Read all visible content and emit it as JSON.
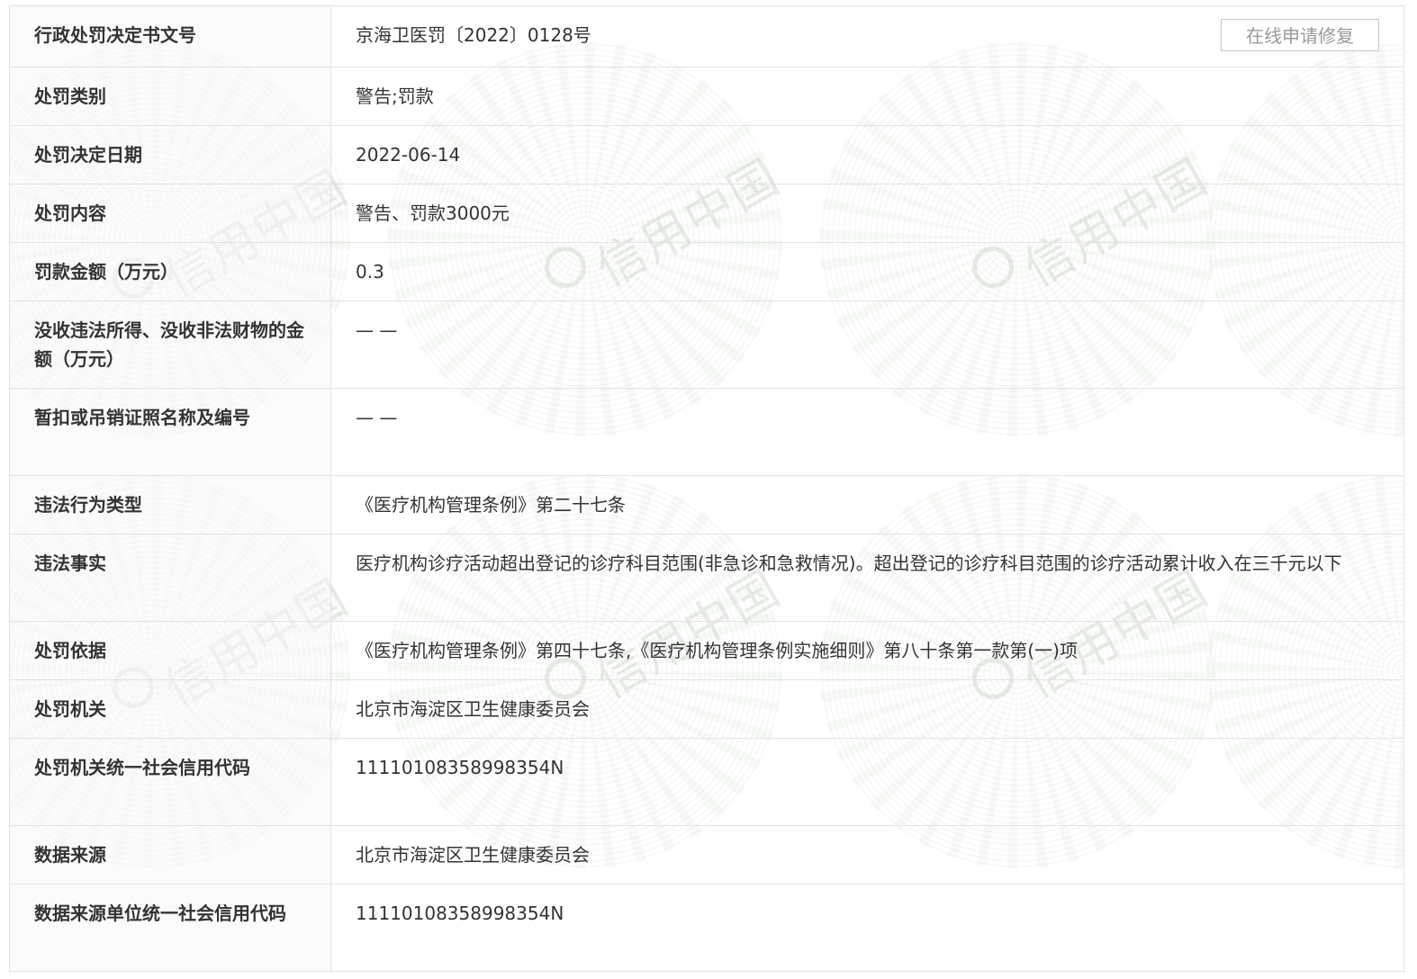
{
  "repair_button_label": "在线申请修复",
  "rows": [
    {
      "label": "行政处罚决定书文号",
      "value": "京海卫医罚〔2022〕0128号"
    },
    {
      "label": "处罚类别",
      "value": "警告;罚款"
    },
    {
      "label": "处罚决定日期",
      "value": "2022-06-14"
    },
    {
      "label": "处罚内容",
      "value": "警告、罚款3000元"
    },
    {
      "label": "罚款金额（万元）",
      "value": "0.3"
    },
    {
      "label": "没收违法所得、没收非法财物的金额（万元）",
      "value": "— —"
    },
    {
      "label": "暂扣或吊销证照名称及编号",
      "value": "— —"
    },
    {
      "label": "违法行为类型",
      "value": "《医疗机构管理条例》第二十七条"
    },
    {
      "label": "违法事实",
      "value": "医疗机构诊疗活动超出登记的诊疗科目范围(非急诊和急救情况)。超出登记的诊疗科目范围的诊疗活动累计收入在三千元以下"
    },
    {
      "label": "处罚依据",
      "value": "《医疗机构管理条例》第四十七条,《医疗机构管理条例实施细则》第八十条第一款第(一)项"
    },
    {
      "label": "处罚机关",
      "value": "北京市海淀区卫生健康委员会"
    },
    {
      "label": "处罚机关统一社会信用代码",
      "value": "11110108358998354N"
    },
    {
      "label": "数据来源",
      "value": "北京市海淀区卫生健康委员会"
    },
    {
      "label": "数据来源单位统一社会信用代码",
      "value": "11110108358998354N"
    }
  ],
  "watermark": {
    "text": "信用中国",
    "icon": "credit-china-logo-icon"
  }
}
